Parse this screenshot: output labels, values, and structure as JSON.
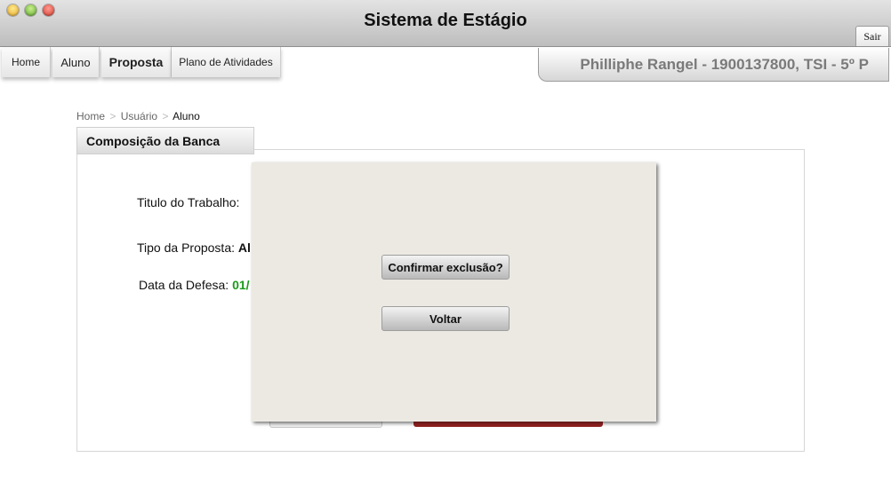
{
  "window": {
    "title": "Sistema de Estágio",
    "logout_label": "Sair"
  },
  "nav": {
    "tabs": [
      {
        "label": "Home"
      },
      {
        "label": "Aluno"
      },
      {
        "label": "Proposta"
      },
      {
        "label": "Plano de Atividades"
      }
    ],
    "user_info": "Philliphe Rangel - 1900137800, TSI - 5º P"
  },
  "breadcrumb": {
    "items": [
      "Home",
      "Usuário",
      "Aluno"
    ],
    "separator": ">"
  },
  "section": {
    "title": "Composição da Banca"
  },
  "form": {
    "titulo_label": "Titulo do Trabalho:",
    "tipo_label": "Tipo da Proposta:",
    "tipo_value_partial": "Al",
    "data_label": "Data da Defesa:",
    "data_value_partial": "01/"
  },
  "modal": {
    "confirm_label": "Confirmar exclusão?",
    "back_label": "Voltar"
  },
  "colors": {
    "date_value": "#1a9a1a",
    "danger_button": "#b02a2a"
  }
}
